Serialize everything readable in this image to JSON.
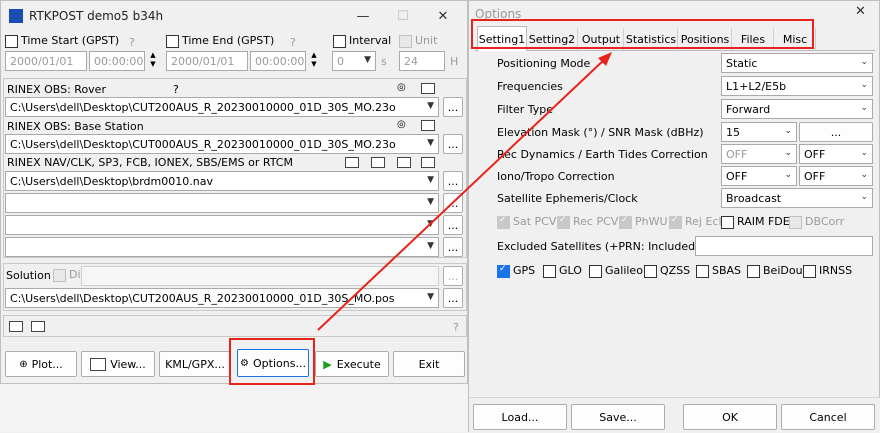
{
  "rtkpost": {
    "title": "RTKPOST demo5 b34h",
    "minimize": "—",
    "maximize": "☐",
    "close": "✕",
    "time_start": {
      "label": "Time Start (GPST)",
      "help": "?",
      "date": "2000/01/01",
      "time": "00:00:00"
    },
    "time_end": {
      "label": "Time End (GPST)",
      "help": "?",
      "date": "2000/01/01",
      "time": "00:00:00"
    },
    "interval": {
      "label": "Interval",
      "value": "0",
      "unit": "s"
    },
    "unit": {
      "label": "Unit",
      "value": "24",
      "unit": "H"
    },
    "rover": {
      "label": "RINEX OBS: Rover",
      "help": "?",
      "path": "C:\\Users\\dell\\Desktop\\CUT200AUS_R_20230010000_01D_30S_MO.23o"
    },
    "base": {
      "label": "RINEX OBS: Base Station",
      "path": "C:\\Users\\dell\\Desktop\\CUT000AUS_R_20230010000_01D_30S_MO.23o"
    },
    "nav": {
      "label": "RINEX NAV/CLK, SP3, FCB, IONEX, SBS/EMS  or RTCM",
      "path1": "C:\\Users\\dell\\Desktop\\brdm0010.nav",
      "path2": "",
      "path3": "",
      "path4": ""
    },
    "browse": "...",
    "solution": {
      "label": "Solution",
      "dir_label": "Dir",
      "path": "C:\\Users\\dell\\Desktop\\CUT200AUS_R_20230010000_01D_30S_MO.pos"
    },
    "status_help": "?",
    "buttons": {
      "plot": "Plot...",
      "view": "View...",
      "kml": "KML/GPX...",
      "options": "Options...",
      "execute": "Execute",
      "exit": "Exit"
    }
  },
  "options": {
    "title": "Options",
    "close": "✕",
    "tabs": [
      "Setting1",
      "Setting2",
      "Output",
      "Statistics",
      "Positions",
      "Files",
      "Misc"
    ],
    "rows": {
      "positioning_mode": {
        "label": "Positioning Mode",
        "value": "Static"
      },
      "frequencies": {
        "label": "Frequencies",
        "value": "L1+L2/E5b"
      },
      "filter_type": {
        "label": "Filter Type",
        "value": "Forward"
      },
      "elevation_mask": {
        "label": "Elevation Mask (°) / SNR Mask (dBHz)",
        "value": "15",
        "button": "..."
      },
      "rec_dynamics": {
        "label": "Rec Dynamics / Earth Tides Correction",
        "value1": "OFF",
        "value2": "OFF"
      },
      "iono_tropo": {
        "label": "Iono/Tropo Correction",
        "value1": "OFF",
        "value2": "OFF"
      },
      "ephemeris": {
        "label": "Satellite Ephemeris/Clock",
        "value": "Broadcast"
      },
      "excluded": {
        "label": "Excluded Satellites (+PRN: Included)",
        "value": ""
      }
    },
    "checks": [
      "Sat PCV",
      "Rec PCV",
      "PhWU",
      "Rej Ecl",
      "RAIM FDE",
      "DBCorr"
    ],
    "systems": [
      "GPS",
      "GLO",
      "Galileo",
      "QZSS",
      "SBAS",
      "BeiDou",
      "IRNSS"
    ],
    "buttons": {
      "load": "Load...",
      "save": "Save...",
      "ok": "OK",
      "cancel": "Cancel"
    }
  },
  "colors": {
    "annotation_red": "#e8231c",
    "check_blue": "#1a73e8",
    "execute_green": "#1aa01a"
  }
}
